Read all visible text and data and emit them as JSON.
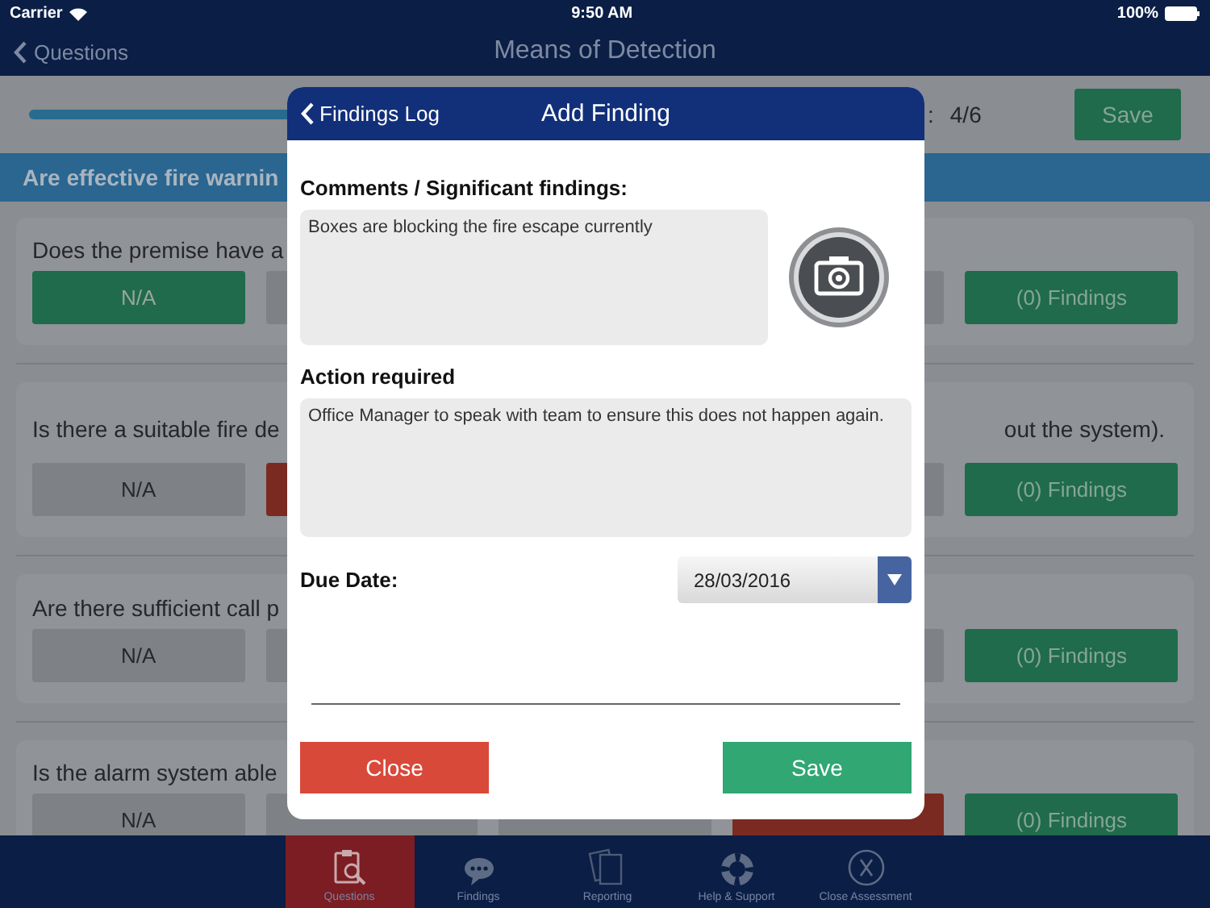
{
  "status_bar": {
    "carrier": "Carrier",
    "time": "9:50 AM",
    "battery": "100%"
  },
  "nav": {
    "back": "Questions",
    "title": "Means of Detection"
  },
  "progress": {
    "level": 0.67,
    "separator": ":",
    "counter": "4/6",
    "save": "Save"
  },
  "section_title": "Are effective fire warnin",
  "questions": [
    {
      "text": "Does the premise have a",
      "answers": [
        {
          "label": "N/A",
          "selected": true,
          "color": "#1f6b4b"
        },
        {
          "selected": false
        },
        {
          "selected": false
        }
      ],
      "findings": "(0) Findings"
    },
    {
      "text": "Is there a suitable fire de",
      "text_end": "out the system).",
      "answers": [
        {
          "label": "N/A",
          "selected": false
        },
        {
          "selected": true,
          "color": "#7b2a22"
        },
        {
          "selected": false
        }
      ],
      "findings": "(0) Findings"
    },
    {
      "text": "Are there sufficient call p",
      "answers": [
        {
          "label": "N/A",
          "selected": false
        },
        {
          "selected": false
        },
        {
          "selected": false
        }
      ],
      "findings": "(0) Findings"
    },
    {
      "text": "Is the alarm system able",
      "answers": [
        {
          "label": "N/A",
          "selected": false
        },
        {
          "selected": false
        },
        {
          "selected": false
        },
        {
          "selected": true,
          "color": "#7b2a22"
        }
      ],
      "findings": "(0) Findings"
    }
  ],
  "tabs": [
    {
      "label": "Questions",
      "selected": true
    },
    {
      "label": "Findings",
      "selected": false
    },
    {
      "label": "Reporting",
      "selected": false
    },
    {
      "label": "Help & Support",
      "selected": false
    },
    {
      "label": "Close Assessment",
      "selected": false
    }
  ],
  "dialog": {
    "back": "Findings Log",
    "title": "Add Finding",
    "comments_label": "Comments / Significant findings:",
    "comments": "Boxes are blocking the fire escape currently",
    "action_label": "Action required",
    "action": "Office Manager to speak with team to ensure this does not happen again.",
    "due_label": "Due Date:",
    "due_date": "28/03/2016",
    "close": "Close",
    "save": "Save"
  }
}
